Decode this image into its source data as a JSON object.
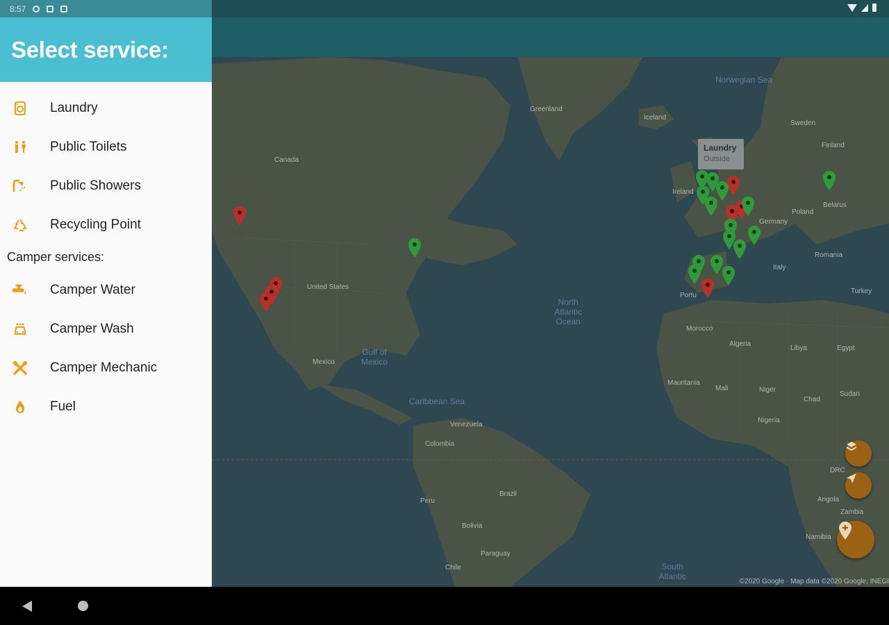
{
  "status_bar": {
    "time": "8:57",
    "icons": [
      "gear-icon",
      "nfc-icon",
      "sd-card-icon",
      "wifi-icon",
      "signal-icon",
      "battery-icon"
    ]
  },
  "drawer": {
    "title": "Select service:",
    "items": [
      {
        "label": "Laundry",
        "icon": "laundry-icon"
      },
      {
        "label": "Public Toilets",
        "icon": "toilets-icon"
      },
      {
        "label": "Public Showers",
        "icon": "shower-icon"
      },
      {
        "label": "Recycling Point",
        "icon": "recycle-icon"
      }
    ],
    "section_label": "Camper services:",
    "camper_items": [
      {
        "label": "Camper Water",
        "icon": "water-tap-icon"
      },
      {
        "label": "Camper Wash",
        "icon": "car-wash-icon"
      },
      {
        "label": "Camper Mechanic",
        "icon": "tools-icon"
      },
      {
        "label": "Fuel",
        "icon": "fuel-icon"
      }
    ],
    "accent_color": "#f39c12",
    "header_color": "#49bfd1"
  },
  "map": {
    "labels": {
      "greenland": "Greenland",
      "iceland": "Iceland",
      "canada": "Canada",
      "united_states": "United States",
      "mexico": "Mexico",
      "gulf": "Gulf of Mexico",
      "caribbean": "Caribbean Sea",
      "north_atlantic": "North Atlantic Ocean",
      "south_atlantic": "South Atlantic",
      "norwegian_sea": "Norwegian Sea",
      "sweden": "Sweden",
      "finland": "Finland",
      "poland": "Poland",
      "belarus": "Belarus",
      "germany": "Germany",
      "romania": "Romania",
      "italy": "Italy",
      "turkey": "Turkey",
      "morocco": "Morocco",
      "algeria": "Algeria",
      "libya": "Libya",
      "egypt": "Egypt",
      "mali": "Mali",
      "niger": "Niger",
      "chad": "Chad",
      "sudan": "Sudan",
      "nigeria": "Nigeria",
      "mauritania": "Mauritania",
      "colombia": "Colombia",
      "venezuela": "Venezuela",
      "brazil": "Brazil",
      "peru": "Peru",
      "bolivia": "Bolivia",
      "paraguay": "Paraguay",
      "chile": "Chile",
      "drc": "DRC",
      "angola": "Angola",
      "zambia": "Zambia",
      "namibia": "Namibia",
      "ireland": "Ireland",
      "portugal": "Portu"
    },
    "tooltip": {
      "title": "Laundry",
      "subtitle": "Outside"
    },
    "attribution": "©2020 Google · Map data ©2020 Google, INEGI",
    "marker_colors": {
      "available": "#2e9a3a",
      "unavailable": "#b8302a"
    }
  },
  "fabs": {
    "layers": "layers-icon",
    "locate": "navigation-arrow-icon",
    "add": "add-location-icon",
    "color": "#9a6212"
  },
  "nav_bar": {
    "back": "back-icon",
    "home": "home-icon"
  }
}
